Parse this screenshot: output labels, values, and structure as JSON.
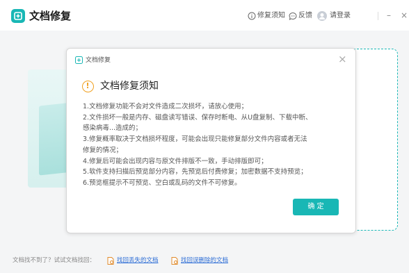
{
  "app": {
    "title": "文档修复"
  },
  "header": {
    "notice_link": "修复须知",
    "feedback_link": "反馈",
    "login_link": "请登录",
    "minimize": "–",
    "close": "×"
  },
  "dialog": {
    "title": "文档修复",
    "close": "×",
    "notice_title": "文档修复须知",
    "notice_icon": "!",
    "lines": [
      "1.文档修复功能不会对文件造成二次损坏，请放心使用；",
      "2.文件损坏一般是内存、磁盘读写错误、保存时断电、从U盘复制、下载中断、",
      "感染病毒...造成的；",
      "3.修复概率取决于文档损坏程度，可能会出现只能修复部分文件内容或者无法",
      "修复的情况；",
      "4.修复后可能会出现内容与原文件排版不一致，手动排版即可；",
      "5.软件支持扫描后预览部分内容，先预览后付费修复；加密数据不支持预览；",
      "6.预览框提示不可预览、空白或乱码的文件不可修复。"
    ],
    "ok_label": "确 定"
  },
  "footer": {
    "hint": "文档找不到了？试试文档找回：",
    "link_lost": "找回丢失的文档",
    "link_deleted": "找回误删除的文档"
  },
  "colors": {
    "accent": "#19b7b5",
    "warning": "#f0a020",
    "link": "#2f6fd6"
  },
  "icons": [
    "app-logo-icon",
    "info-icon",
    "chat-icon",
    "user-avatar-icon",
    "notice-warning-icon",
    "document-icon"
  ]
}
